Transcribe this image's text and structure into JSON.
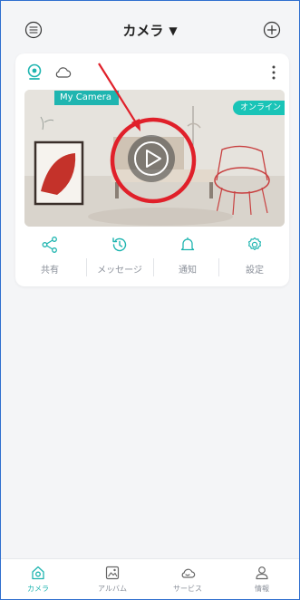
{
  "header": {
    "title": "カメラ",
    "left_icon": "scan-icon",
    "right_icon": "add-icon"
  },
  "camera_card": {
    "name": "My Camera",
    "status": "オンライン",
    "status_icons": [
      "camera-icon",
      "cloud-icon"
    ],
    "actions": [
      {
        "label": "共有",
        "icon": "share-icon"
      },
      {
        "label": "メッセージ",
        "icon": "history-icon"
      },
      {
        "label": "通知",
        "icon": "bell-icon"
      },
      {
        "label": "設定",
        "icon": "gear-icon"
      }
    ]
  },
  "tabbar": {
    "tabs": [
      {
        "label": "カメラ",
        "icon": "camera-home-icon",
        "active": true
      },
      {
        "label": "アルバム",
        "icon": "album-icon",
        "active": false
      },
      {
        "label": "サービス",
        "icon": "cloud-service-icon",
        "active": false
      },
      {
        "label": "情報",
        "icon": "user-icon",
        "active": false
      }
    ]
  },
  "colors": {
    "accent": "#1fb5b0",
    "annotation": "#e0202a",
    "border": "#2f6fcf"
  }
}
